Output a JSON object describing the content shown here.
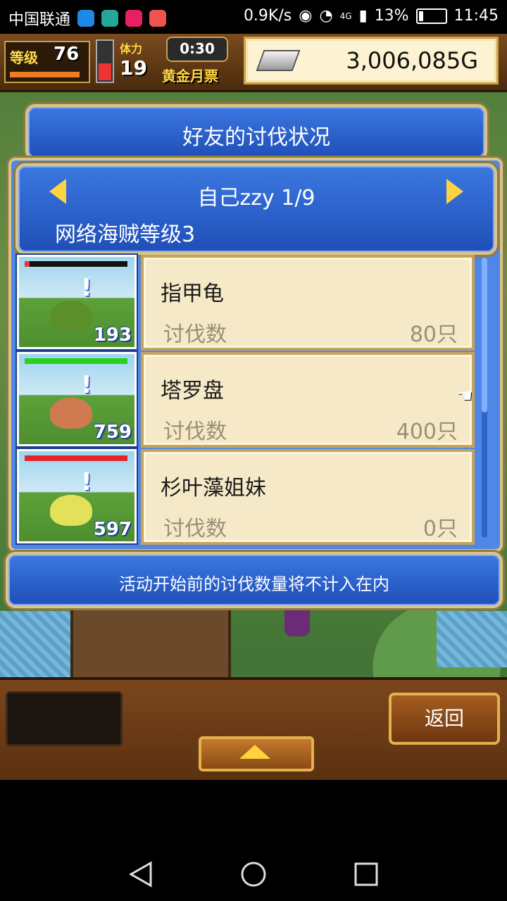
{
  "status_bar": {
    "carrier": "中国联通",
    "net_speed": "0.9K/s",
    "network_type": "4G",
    "battery": "13%",
    "time": "11:45",
    "icons": [
      "moon-icon",
      "timer-icon",
      "heart-icon",
      "mail-icon",
      "eye-icon",
      "wifi-icon",
      "signal-icon",
      "battery-icon"
    ]
  },
  "hud": {
    "level_label": "等级",
    "level_value": "76",
    "level_progress": 0.95,
    "stamina_label": "体力",
    "stamina_value": "19",
    "stamina_fill": 0.45,
    "timer": "0:30",
    "ticket_label": "黄金月票",
    "gold": "3,006,085G"
  },
  "dialog": {
    "title": "好友的讨伐状况",
    "player": "自己zzy 1/9",
    "rank": "网络海贼等级3",
    "kill_label": "讨伐数",
    "notice": "活动开始前的讨伐数量将不计入在内",
    "monsters": [
      {
        "name": "指甲龟",
        "kills": "80只",
        "count": "193",
        "hp_color": "#111111",
        "hp_fill": 0.05,
        "hp_fill_color": "#e53935",
        "monster_color": "#5a8f2a"
      },
      {
        "name": "塔罗盘",
        "kills": "400只",
        "count": "759",
        "hp_color": "#111111",
        "hp_fill": 1.0,
        "hp_fill_color": "#29d11b",
        "monster_color": "#d07a52"
      },
      {
        "name": "杉叶藻姐妹",
        "kills": "0只",
        "count": "597",
        "hp_color": "#111111",
        "hp_fill": 1.0,
        "hp_fill_color": "#e3252a",
        "monster_color": "#e3e05a"
      }
    ]
  },
  "bottom": {
    "back_label": "返回"
  },
  "colors": {
    "accent_gold": "#caa24b",
    "panel_blue": "#3b78e0",
    "card_bg": "#f6e9c7"
  }
}
